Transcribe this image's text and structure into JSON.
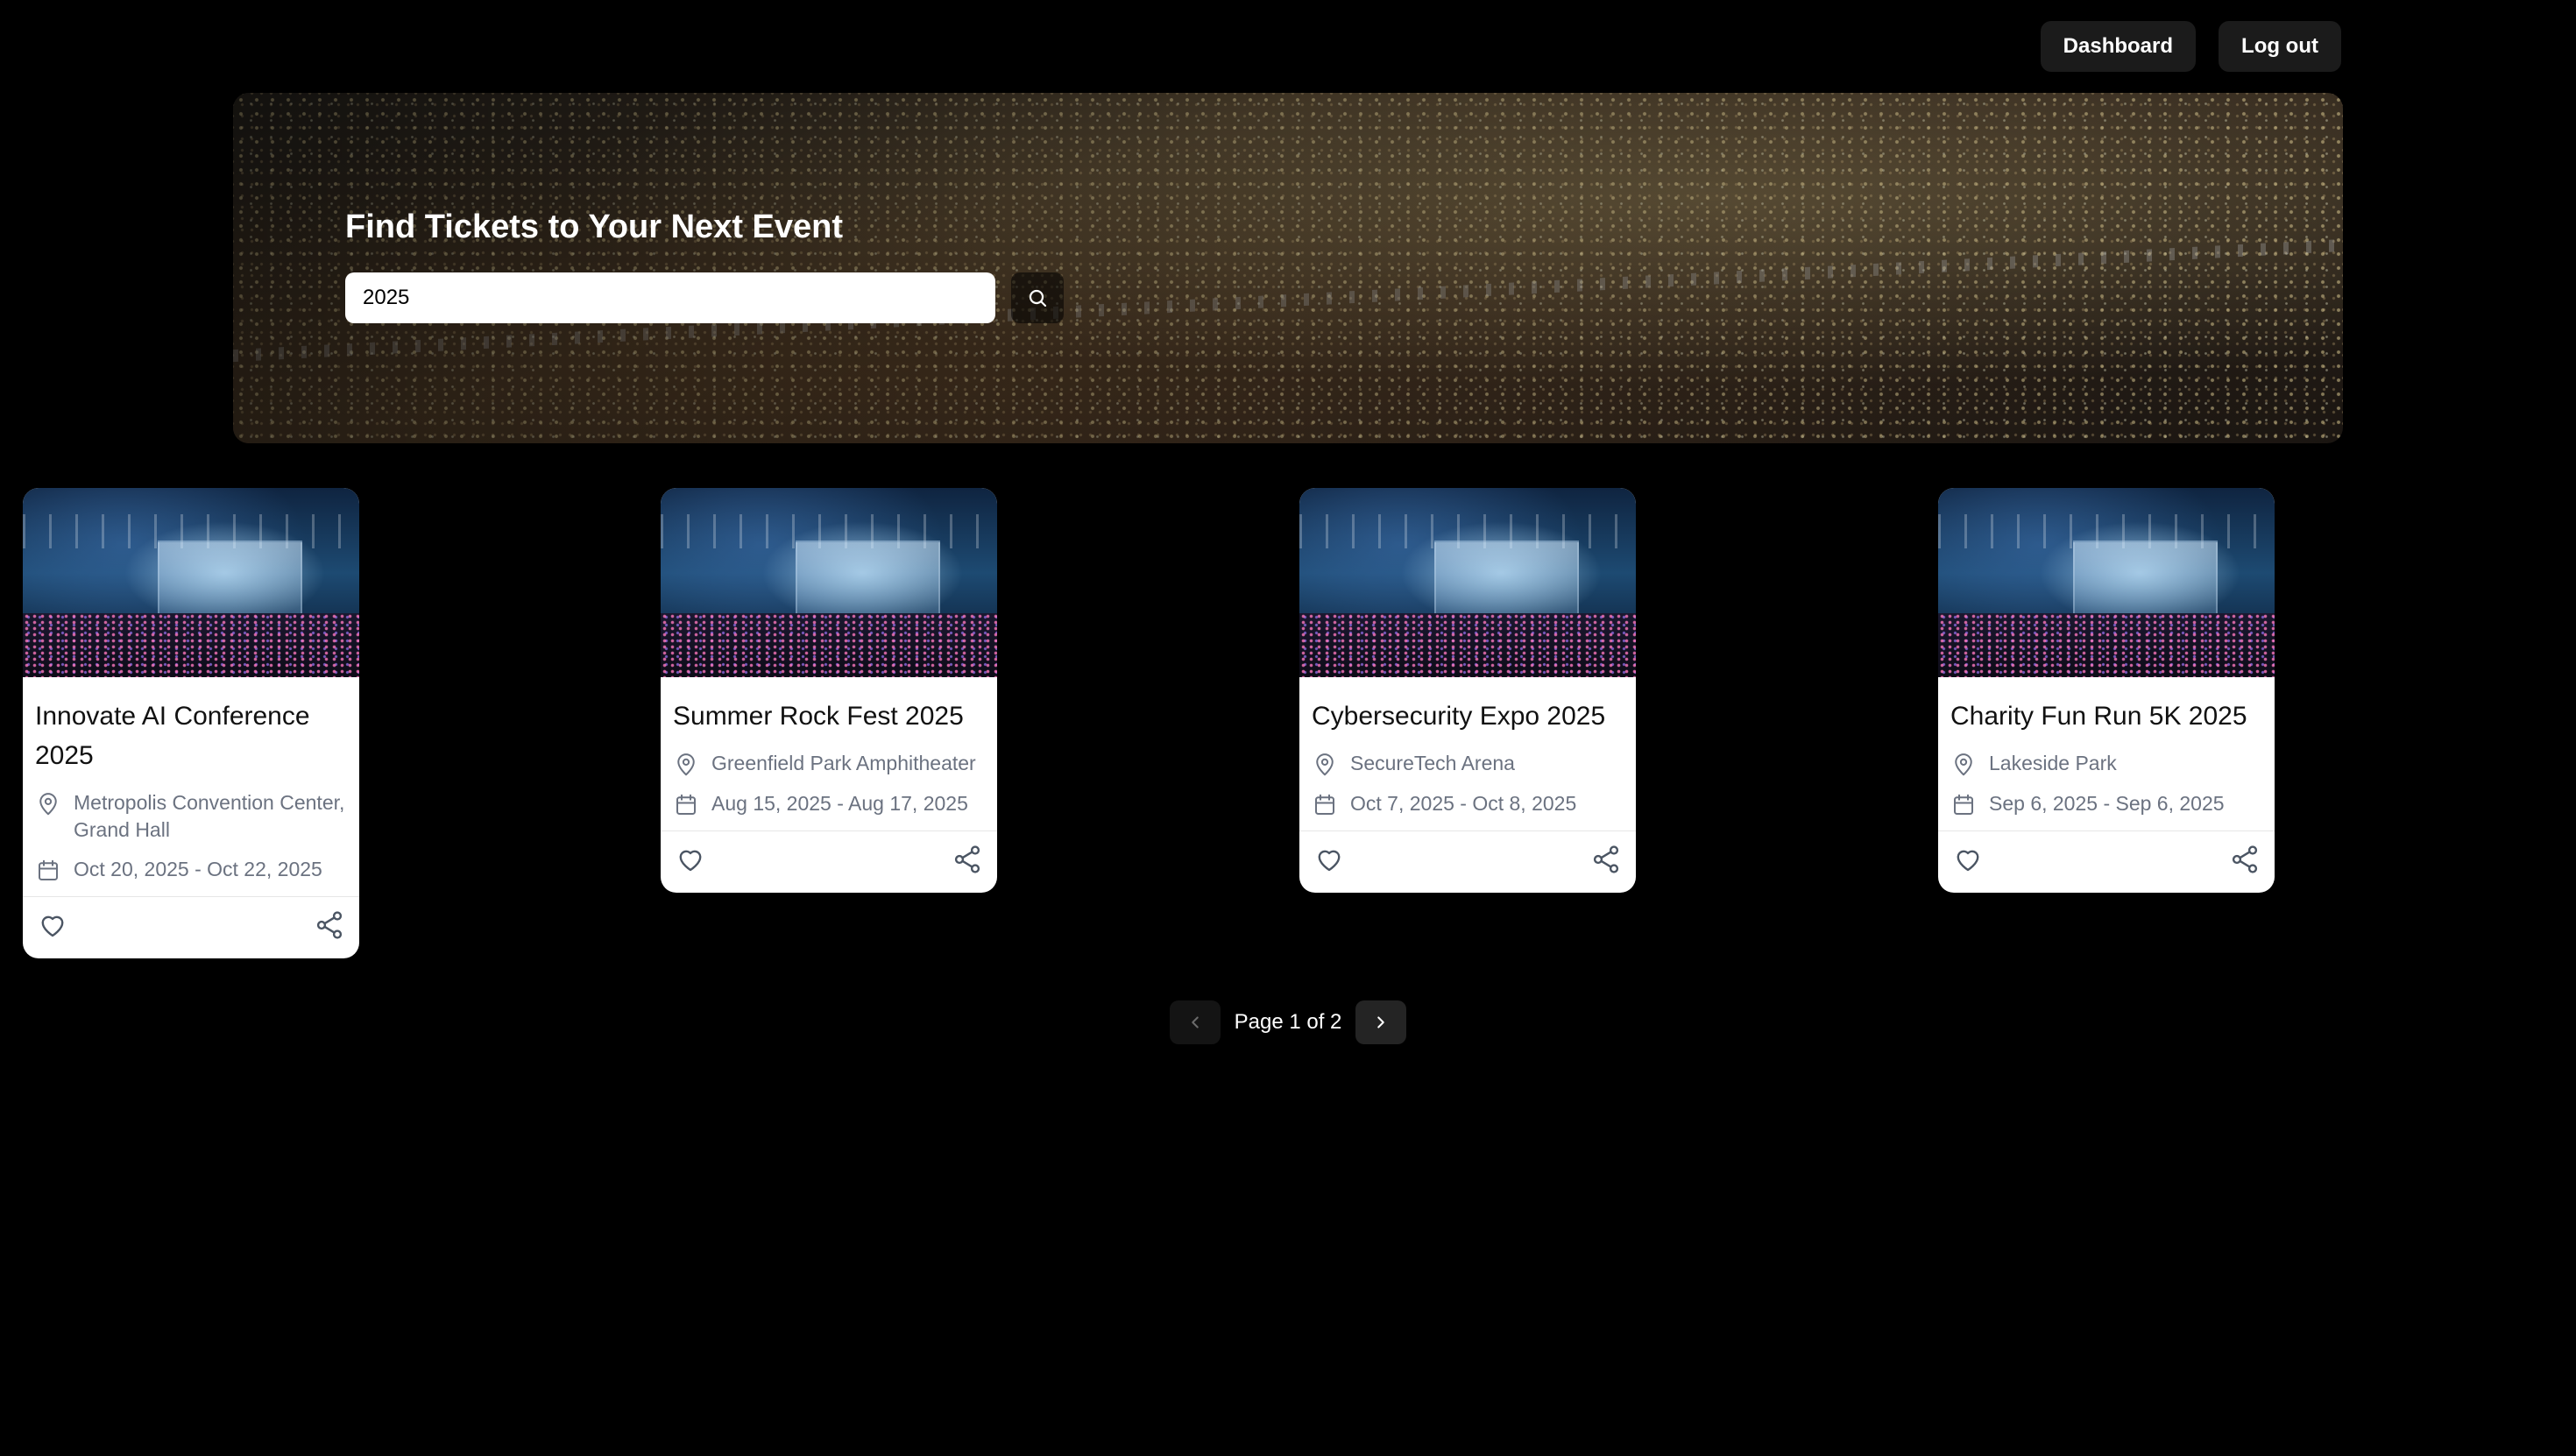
{
  "nav": {
    "dashboard_label": "Dashboard",
    "logout_label": "Log out"
  },
  "hero": {
    "title": "Find Tickets to Your Next Event",
    "search_value": "2025",
    "search_icon": "search-icon"
  },
  "events": [
    {
      "title": "Innovate AI Conference 2025",
      "location": "Metropolis Convention Center, Grand Hall",
      "dates": "Oct 20, 2025 - Oct 22, 2025"
    },
    {
      "title": "Summer Rock Fest 2025",
      "location": "Greenfield Park Amphitheater",
      "dates": "Aug 15, 2025 - Aug 17, 2025"
    },
    {
      "title": "Cybersecurity Expo 2025",
      "location": "SecureTech Arena",
      "dates": "Oct 7, 2025 - Oct 8, 2025"
    },
    {
      "title": "Charity Fun Run 5K 2025",
      "location": "Lakeside Park",
      "dates": "Sep 6, 2025 - Sep 6, 2025"
    }
  ],
  "icons": {
    "location": "map-pin-icon",
    "date": "calendar-icon",
    "favorite": "heart-icon",
    "share": "share-icon",
    "prev": "chevron-left-icon",
    "next": "chevron-right-icon"
  },
  "pagination": {
    "label": "Page 1 of 2",
    "current": 1,
    "total": 2
  },
  "colors": {
    "background": "#000000",
    "card": "#ffffff",
    "muted_text": "#6b7280",
    "button_dark": "#1b1b1b"
  }
}
